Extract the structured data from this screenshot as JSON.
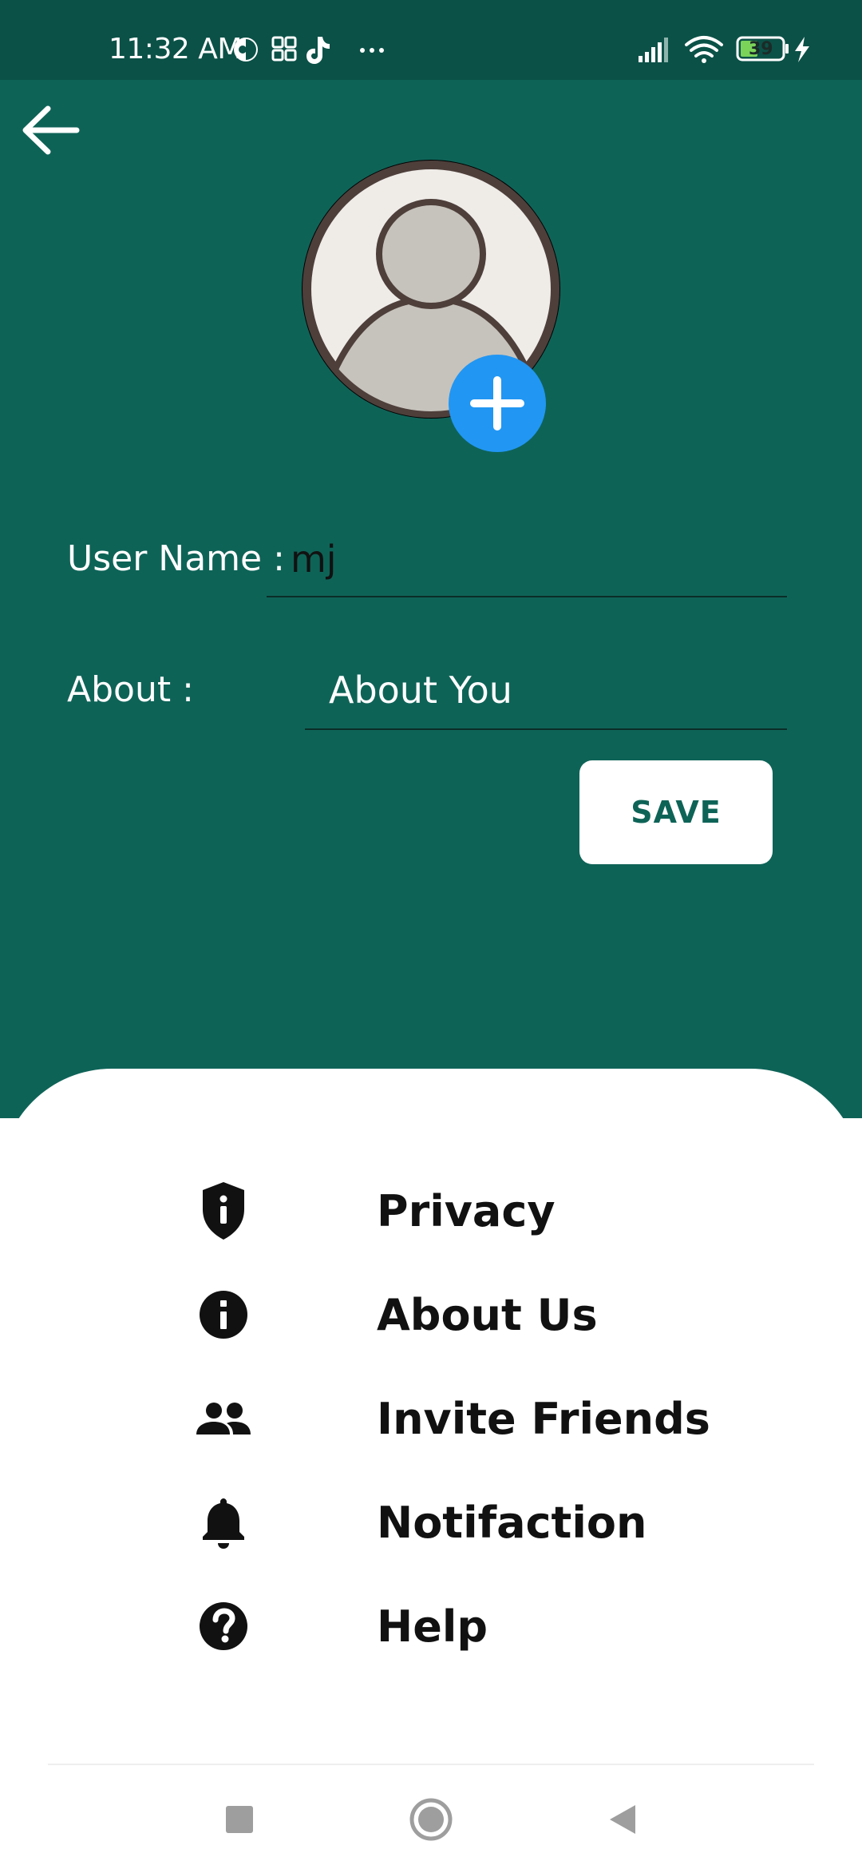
{
  "status_bar": {
    "time": "11:32 AM",
    "battery_level": "39",
    "icons": [
      "app-icon",
      "grid-icon",
      "tiktok-icon",
      "more-dots-icon",
      "signal-icon",
      "wifi-icon",
      "battery-icon",
      "charging-icon"
    ]
  },
  "profile": {
    "back_icon": "arrow-left-icon",
    "avatar_icon": "person-icon",
    "add_photo_icon": "plus-icon",
    "user_name_label": "User Name :",
    "user_name_value": "mj",
    "about_label": "About :",
    "about_placeholder": "About You",
    "save_label": "SAVE"
  },
  "menu": {
    "items": [
      {
        "label": "Privacy",
        "icon": "shield-icon"
      },
      {
        "label": "About Us",
        "icon": "info-icon"
      },
      {
        "label": "Invite Friends",
        "icon": "people-icon"
      },
      {
        "label": "Notifaction",
        "icon": "bell-icon"
      },
      {
        "label": "Help",
        "icon": "help-icon"
      }
    ]
  },
  "nav_bar": {
    "buttons": [
      "recents-icon",
      "home-icon",
      "back-triangle-icon"
    ]
  },
  "colors": {
    "primary": "#0e6357",
    "status_bar": "#0b5147",
    "accent": "#2196f3",
    "surface": "#ffffff"
  }
}
